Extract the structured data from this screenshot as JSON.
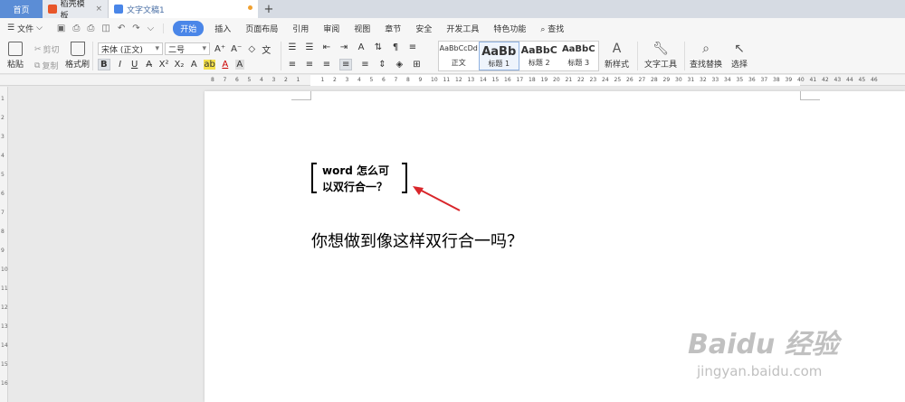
{
  "tabs": {
    "home": "首页",
    "template": "稻壳模板",
    "document": "文字文稿1",
    "add": "+",
    "close": "×"
  },
  "menu": {
    "file": "文件",
    "items": [
      "开始",
      "插入",
      "页面布局",
      "引用",
      "审阅",
      "视图",
      "章节",
      "安全",
      "开发工具",
      "特色功能"
    ],
    "search": "查找",
    "active_color": "#4a86e8"
  },
  "ribbon": {
    "paste": "粘贴",
    "cut": "剪切",
    "copy": "复制",
    "format_painter": "格式刷",
    "font_name": "宋体 (正文)",
    "font_size": "二号",
    "styles": [
      {
        "sample": "AaBbCcDd",
        "name": "正文"
      },
      {
        "sample": "AaBb",
        "name": "标题 1"
      },
      {
        "sample": "AaBbC",
        "name": "标题 2"
      },
      {
        "sample": "AaBbC",
        "name": "标题 3"
      }
    ],
    "new_style": "新样式",
    "text_tools": "文字工具",
    "find_replace": "查找替换",
    "select": "选择"
  },
  "ruler": {
    "left_ticks": [
      "8",
      "7",
      "6",
      "5",
      "4",
      "3",
      "2",
      "1"
    ],
    "right_ticks": [
      "1",
      "2",
      "3",
      "4",
      "5",
      "6",
      "7",
      "8",
      "9",
      "10",
      "11",
      "12",
      "13",
      "14",
      "15",
      "16",
      "17",
      "18",
      "19",
      "20",
      "21",
      "22",
      "23",
      "24",
      "25",
      "26",
      "27",
      "28",
      "29",
      "30",
      "31",
      "32",
      "33",
      "34",
      "35",
      "36",
      "37",
      "38",
      "39",
      "40",
      "41",
      "42",
      "43",
      "44",
      "45",
      "46"
    ],
    "vertical_ticks": [
      "1",
      "2",
      "3",
      "4",
      "5",
      "6",
      "7",
      "8",
      "9",
      "10",
      "11",
      "12",
      "13",
      "14",
      "15",
      "16"
    ]
  },
  "document": {
    "combined_line1": "word 怎么可",
    "combined_line2": "以双行合一？",
    "body": "你想做到像这样双行合一吗？"
  },
  "watermark": {
    "main": "Baidu 经验",
    "sub": "jingyan.baidu.com"
  },
  "colors": {
    "arrow": "#d9262b",
    "home_tab": "#5b8dd6"
  }
}
